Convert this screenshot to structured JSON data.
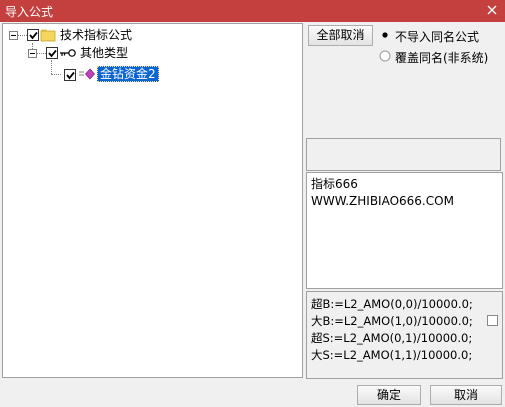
{
  "window": {
    "title": "导入公式"
  },
  "tree": {
    "root": {
      "label": "技术指标公式",
      "checked": true
    },
    "child": {
      "label": "其他类型",
      "checked": true
    },
    "leaf": {
      "label": "金钻资金2",
      "checked": true,
      "selected": true
    }
  },
  "actions": {
    "deselect_all": "全部取消",
    "options": [
      {
        "label": "不导入同名公式",
        "selected": true
      },
      {
        "label": "覆盖同名(非系统)",
        "selected": false
      }
    ]
  },
  "description": {
    "lines": [
      "指标666",
      "WWW.ZHIBIAO666.COM"
    ]
  },
  "code": {
    "lines": [
      "超B:=L2_AMO(0,0)/10000.0;",
      "大B:=L2_AMO(1,0)/10000.0;",
      "超S:=L2_AMO(0,1)/10000.0;",
      "大S:=L2_AMO(1,1)/10000.0;"
    ],
    "checked": false
  },
  "footer": {
    "ok": "确定",
    "cancel": "取消"
  }
}
